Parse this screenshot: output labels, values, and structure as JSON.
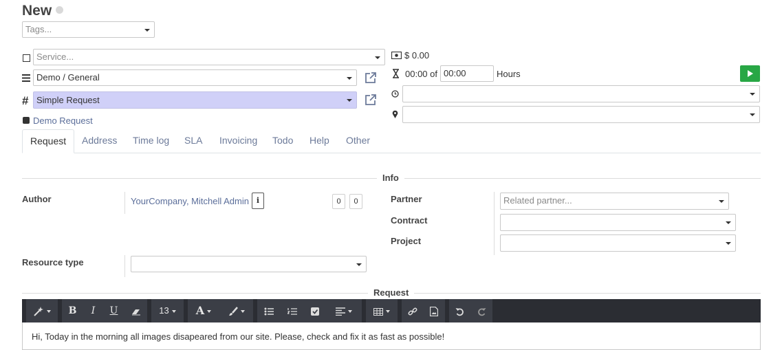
{
  "record": {
    "title": "New"
  },
  "tags": {
    "placeholder": "Tags..."
  },
  "service": {
    "placeholder": "Service..."
  },
  "category": {
    "value": "Demo / General"
  },
  "request_type": {
    "value": "Simple Request"
  },
  "kind": {
    "label": "Demo Request"
  },
  "price": {
    "value": "$ 0.00"
  },
  "time": {
    "spent": "00:00 of",
    "planned": "00:00",
    "unit": "Hours"
  },
  "tabs": [
    {
      "label": "Request",
      "active": true
    },
    {
      "label": "Address"
    },
    {
      "label": "Time log"
    },
    {
      "label": "SLA"
    },
    {
      "label": "Invoicing"
    },
    {
      "label": "Todo"
    },
    {
      "label": "Help"
    },
    {
      "label": "Other"
    }
  ],
  "info_section": {
    "title": "Info"
  },
  "author": {
    "label": "Author",
    "value": "YourCompany, Mitchell Admin",
    "count_a": "0",
    "count_b": "0"
  },
  "partner": {
    "label": "Partner",
    "placeholder": "Related partner..."
  },
  "contract": {
    "label": "Contract"
  },
  "project": {
    "label": "Project"
  },
  "resource_type": {
    "label": "Resource type"
  },
  "request_section": {
    "title": "Request"
  },
  "toolbar": {
    "font_size": "13"
  },
  "editor": {
    "text": "Hi, Today in the morning all images disapeared from our site. Please, check and fix it as fast as possible!"
  },
  "colors": {
    "accent_highlight": "#d0d0f8",
    "play_green": "#28a745",
    "toolbar_bg": "#2b2d33",
    "link": "#5b6e9a"
  }
}
